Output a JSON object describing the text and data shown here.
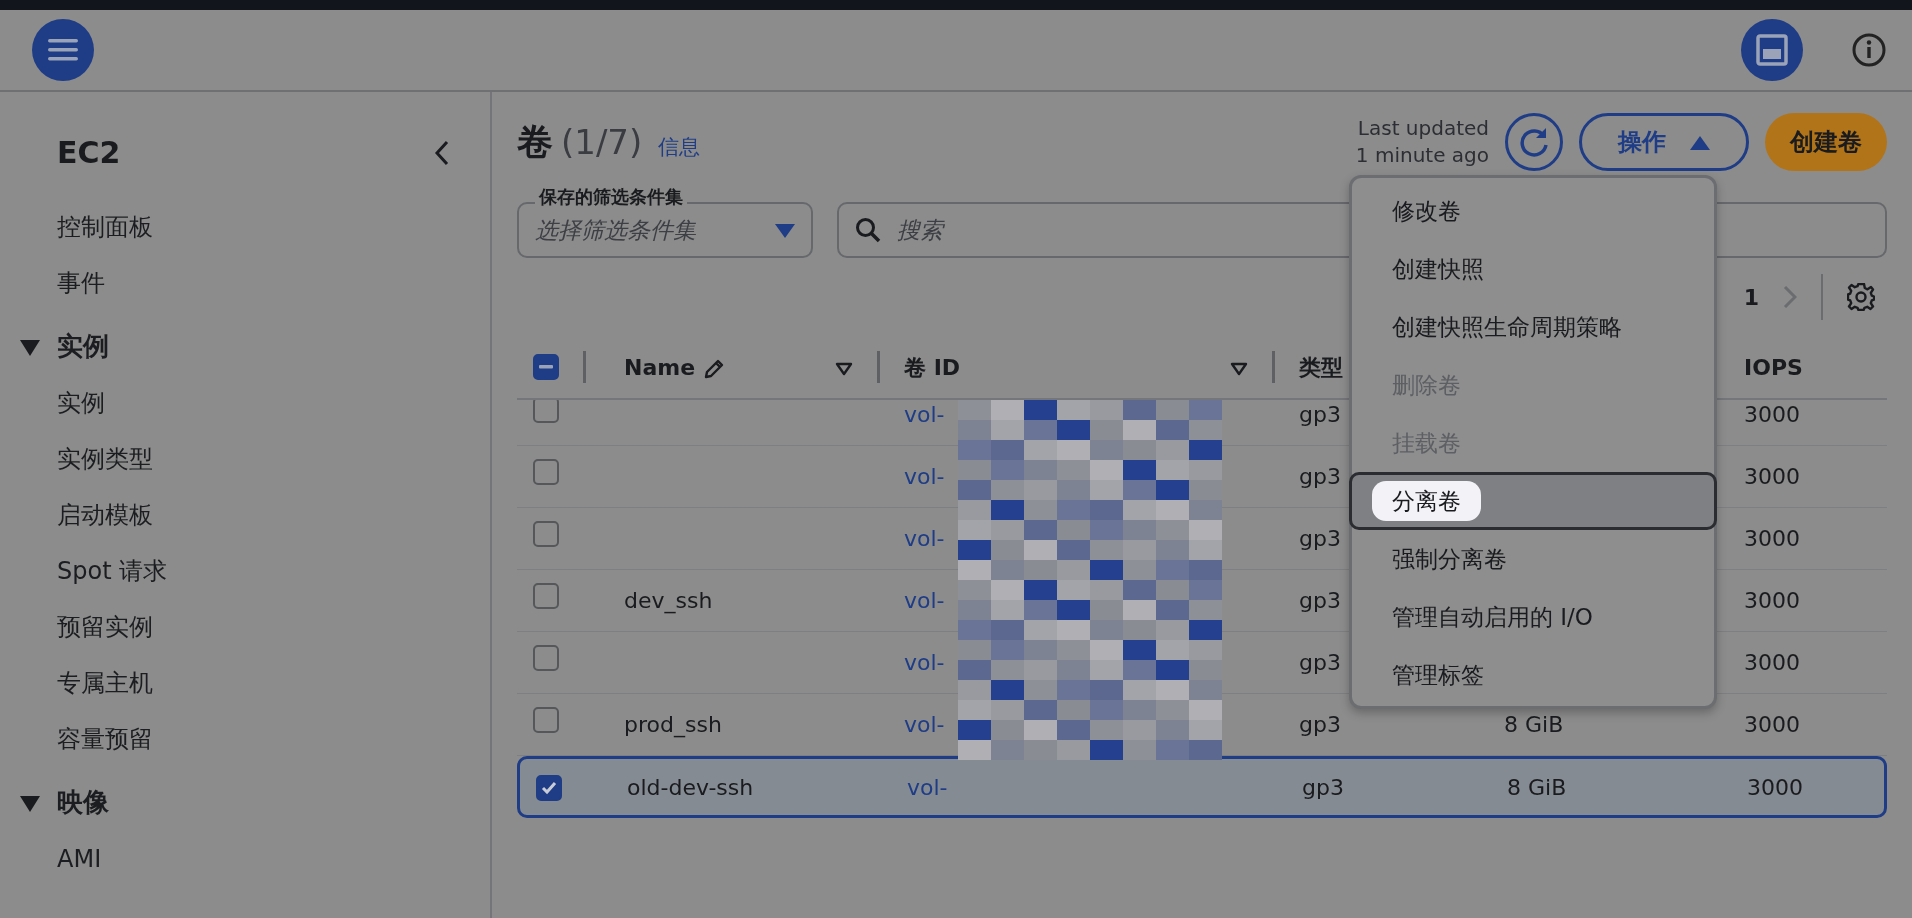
{
  "sidebar": {
    "title": "EC2",
    "items": [
      {
        "label": "控制面板"
      },
      {
        "label": "事件"
      },
      {
        "label": "实例",
        "expanded": true,
        "children": [
          {
            "label": "实例"
          },
          {
            "label": "实例类型"
          },
          {
            "label": "启动模板"
          },
          {
            "label": "Spot 请求"
          },
          {
            "label": "预留实例"
          },
          {
            "label": "专属主机"
          },
          {
            "label": "容量预留"
          }
        ]
      },
      {
        "label": "映像",
        "expanded": true,
        "children": [
          {
            "label": "AMI"
          }
        ]
      }
    ]
  },
  "page": {
    "title": "卷",
    "count": "(1/7)",
    "info_link": "信息",
    "last_updated": "Last updated 1 minute ago",
    "actions_button": "操作",
    "actions_open": true,
    "create_button": "创建卷"
  },
  "filters": {
    "saved_label": "保存的筛选条件集",
    "saved_placeholder": "选择筛选条件集",
    "search_placeholder": "搜索"
  },
  "pagination": {
    "page": "1"
  },
  "table": {
    "select_all": {
      "indeterminate": true
    },
    "columns": [
      "Name",
      "卷 ID",
      "类型",
      "IOPS"
    ],
    "rows": [
      {
        "name": "",
        "vol_id": "vol-",
        "type": "gp3",
        "size": "",
        "iops": "3000",
        "selected": false
      },
      {
        "name": "",
        "vol_id": "vol-",
        "type": "gp3",
        "size": "",
        "iops": "3000",
        "selected": false
      },
      {
        "name": "",
        "vol_id": "vol-",
        "type": "gp3",
        "size": "",
        "iops": "3000",
        "selected": false
      },
      {
        "name": "dev_ssh",
        "vol_id": "vol-",
        "type": "gp3",
        "size": "",
        "iops": "3000",
        "selected": false
      },
      {
        "name": "",
        "vol_id": "vol-",
        "type": "gp3",
        "size": "",
        "iops": "3000",
        "selected": false
      },
      {
        "name": "prod_ssh",
        "vol_id": "vol-",
        "type": "gp3",
        "size": "8 GiB",
        "iops": "3000",
        "selected": false
      },
      {
        "name": "old-dev-ssh",
        "vol_id": "vol-",
        "type": "gp3",
        "size": "8 GiB",
        "iops": "3000",
        "selected": true
      }
    ]
  },
  "actions_menu": [
    {
      "label": "修改卷",
      "disabled": false,
      "highlighted": false
    },
    {
      "label": "创建快照",
      "disabled": false,
      "highlighted": false
    },
    {
      "label": "创建快照生命周期策略",
      "disabled": false,
      "highlighted": false
    },
    {
      "label": "删除卷",
      "disabled": true,
      "highlighted": false
    },
    {
      "label": "挂载卷",
      "disabled": true,
      "highlighted": false
    },
    {
      "label": "分离卷",
      "disabled": false,
      "highlighted": true
    },
    {
      "label": "强制分离卷",
      "disabled": false,
      "highlighted": false
    },
    {
      "label": "管理自动启用的 I/O",
      "disabled": false,
      "highlighted": false
    },
    {
      "label": "管理标签",
      "disabled": false,
      "highlighted": false
    }
  ]
}
